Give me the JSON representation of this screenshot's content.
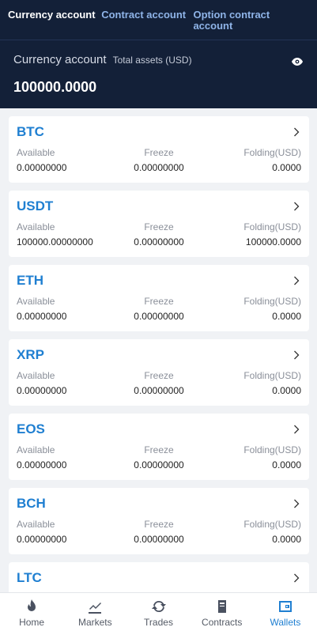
{
  "tabs": [
    {
      "label": "Currency account"
    },
    {
      "label": "Contract account"
    },
    {
      "label": "Option contract account"
    }
  ],
  "summary": {
    "title": "Currency account",
    "subtitle": "Total assets  (USD)",
    "total": "100000.0000",
    "eye_icon": "eye-icon"
  },
  "labels": {
    "available": "Available",
    "freeze": "Freeze",
    "folding": "Folding(USD)"
  },
  "coins": [
    {
      "symbol": "BTC",
      "available": "0.00000000",
      "freeze": "0.00000000",
      "folding": "0.0000"
    },
    {
      "symbol": "USDT",
      "available": "100000.00000000",
      "freeze": "0.00000000",
      "folding": "100000.0000"
    },
    {
      "symbol": "ETH",
      "available": "0.00000000",
      "freeze": "0.00000000",
      "folding": "0.0000"
    },
    {
      "symbol": "XRP",
      "available": "0.00000000",
      "freeze": "0.00000000",
      "folding": "0.0000"
    },
    {
      "symbol": "EOS",
      "available": "0.00000000",
      "freeze": "0.00000000",
      "folding": "0.0000"
    },
    {
      "symbol": "BCH",
      "available": "0.00000000",
      "freeze": "0.00000000",
      "folding": "0.0000"
    },
    {
      "symbol": "LTC",
      "available": "",
      "freeze": "",
      "folding": ""
    }
  ],
  "nav": [
    {
      "label": "Home",
      "icon": "flame-icon"
    },
    {
      "label": "Markets",
      "icon": "chart-icon"
    },
    {
      "label": "Trades",
      "icon": "refresh-icon"
    },
    {
      "label": "Contracts",
      "icon": "document-icon"
    },
    {
      "label": "Wallets",
      "icon": "wallet-icon"
    }
  ],
  "colors": {
    "header_bg": "#132038",
    "accent": "#1f7fd1",
    "tab_inactive": "#8fb4e8",
    "page_bg": "#f0f2f5"
  }
}
